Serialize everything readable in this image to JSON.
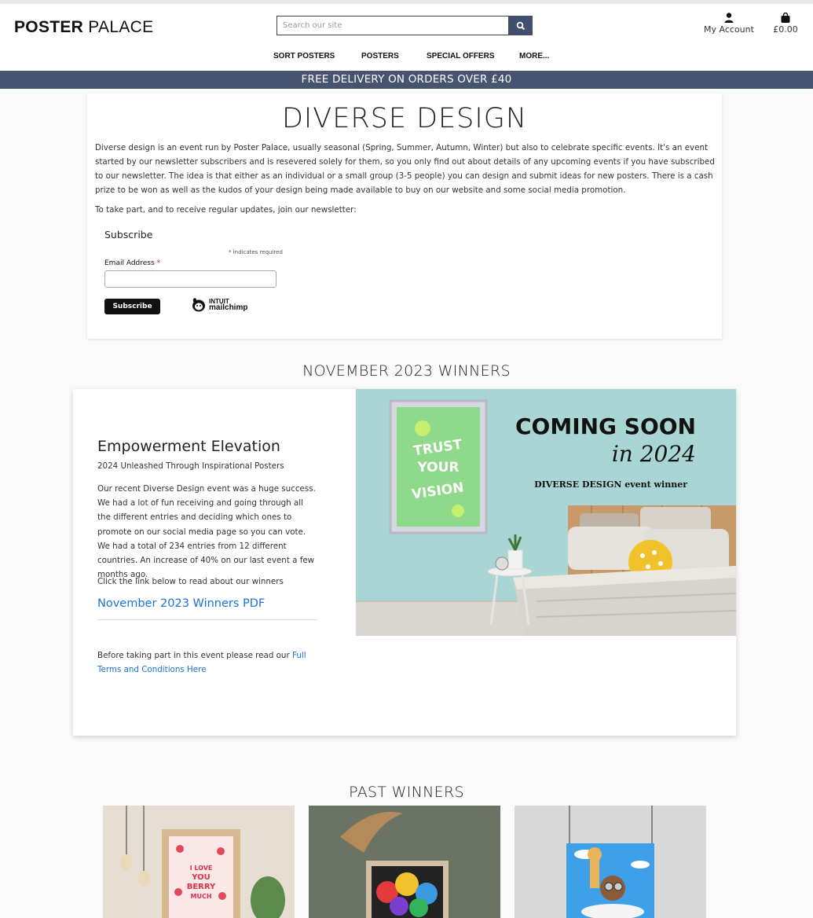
{
  "header": {
    "logo_bold": "POSTER",
    "logo_rest": "PALACE",
    "search_placeholder": "Search our site",
    "account_label": "My Account",
    "bag_total": "£0.00"
  },
  "nav": {
    "items": [
      "SORT POSTERS",
      "POSTERS",
      "SPECIAL OFFERS",
      "MORE..."
    ]
  },
  "banner": "FREE DELIVERY ON ORDERS OVER £40",
  "diverse": {
    "title": "DIVERSE DESIGN",
    "intro": "Diverse design is an event run by Poster Palace, usually seasonal (Spring, Summer, Autumn, Winter) but also to celebrate specific events. It's an event started by our newsletter subscribers and is resevered solely for them, so you only find out about details of any upcoming events if you have subscribed to our newsletter. The idea is that either as an individual or a small group (3-5 people) you can design and submit ideas for new posters. There is a cash prize to be won as well as the kudos of your design being made available to buy on our website and some social media promotion.",
    "join": "To take part, and to receive regular updates, join our newsletter:",
    "subscribe_heading": "Subscribe",
    "required_star": "*",
    "required_note": "indicates required",
    "email_label": "Email Address",
    "subscribe_button": "Subscribe",
    "mailchimp_top": "INTUIT",
    "mailchimp_bottom": "mailchimp"
  },
  "winners": {
    "heading": "NOVEMBER 2023 WINNERS",
    "title": "Empowerment Elevation",
    "subtitle": "2024 Unleashed Through Inspirational Posters",
    "body": "Our recent Diverse Design event was a huge success. We had a lot of fun receiving and going through all the different entries and deciding which ones to promote on our social media page so you can vote. We had a total of 234 entries from 12 different countries. An increase of 40% on our last event a few months ago.",
    "click_text": "Click the link below to read about our winners",
    "pdf_link": "November 2023 Winners PDF",
    "terms_text": "Before taking part in this event please read our",
    "terms_link": "Full Terms and Conditions Here",
    "image": {
      "coming": "COMING SOON",
      "year": "in 2024",
      "caption": "DIVERSE DESIGN event winner",
      "poster_text": "TRUST YOUR VISION"
    }
  },
  "past": {
    "heading": "PAST WINNERS",
    "poster1_text": "I LOVE YOU BERRY MUCH"
  },
  "colors": {
    "brand_navy": "#465470",
    "link_blue": "#1a73d8",
    "teal_bg": "#a9d6d4"
  }
}
